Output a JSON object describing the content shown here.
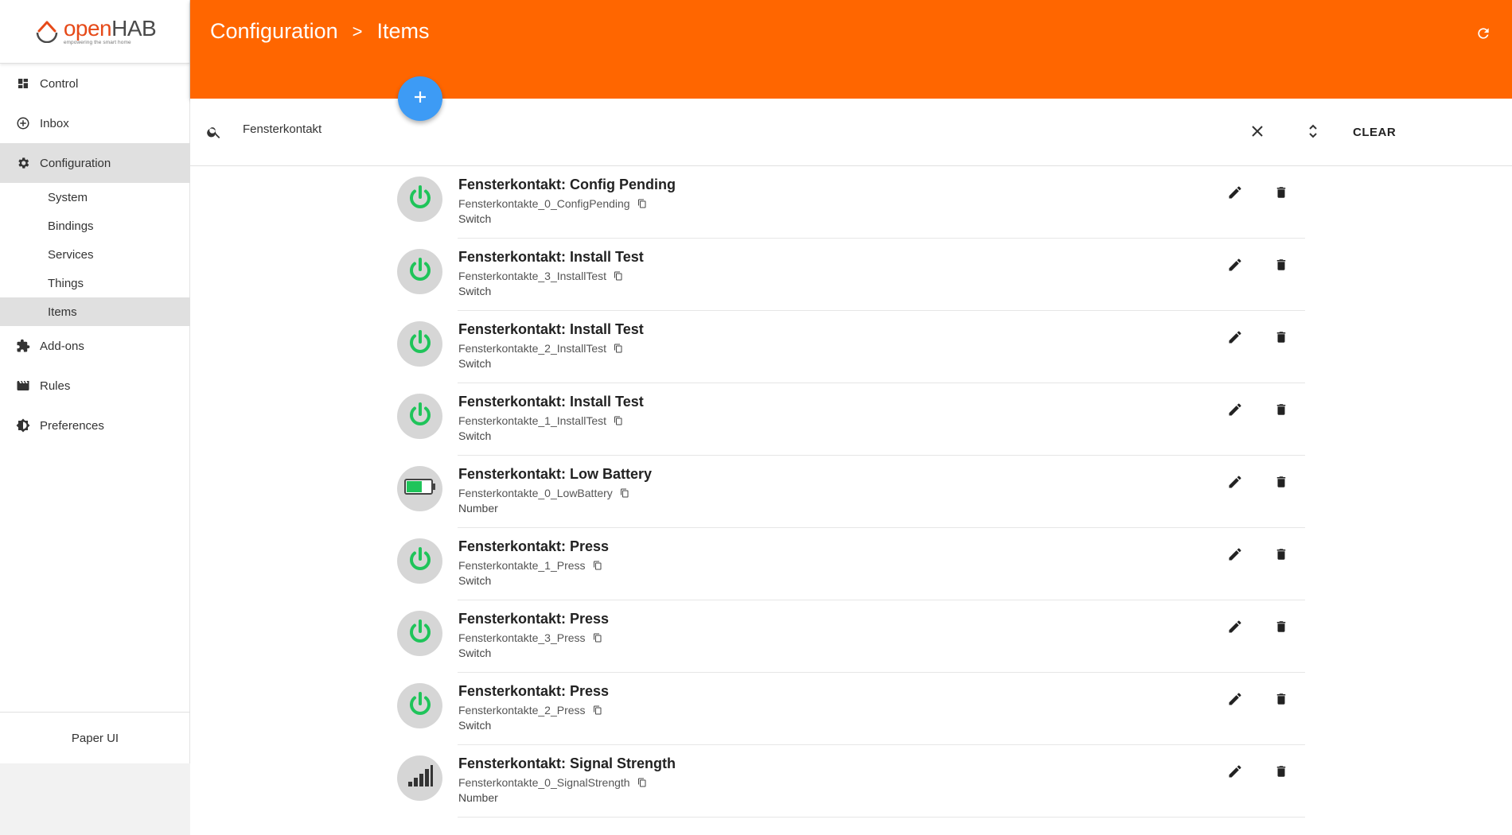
{
  "app": {
    "logo_open": "open",
    "logo_hab": "HAB",
    "logo_tagline": "empowering the smart home",
    "accent_color": "#ff6600",
    "fab_color": "#3d9bf5",
    "status_color": "#1fc45a"
  },
  "header": {
    "crumb1": "Configuration",
    "crumb_sep": ">",
    "crumb2": "Items"
  },
  "sidebar": {
    "control": "Control",
    "inbox": "Inbox",
    "configuration": "Configuration",
    "system": "System",
    "bindings": "Bindings",
    "services": "Services",
    "things": "Things",
    "items": "Items",
    "addons": "Add-ons",
    "rules": "Rules",
    "preferences": "Preferences",
    "footer": "Paper UI"
  },
  "search": {
    "value": "Fensterkontakt",
    "clear_label": "CLEAR"
  },
  "items": [
    {
      "label": "Fensterkontakt: Config Pending",
      "name": "Fensterkontakte_0_ConfigPending",
      "type": "Switch",
      "icon": "power-icon"
    },
    {
      "label": "Fensterkontakt: Install Test",
      "name": "Fensterkontakte_3_InstallTest",
      "type": "Switch",
      "icon": "power-icon"
    },
    {
      "label": "Fensterkontakt: Install Test",
      "name": "Fensterkontakte_2_InstallTest",
      "type": "Switch",
      "icon": "power-icon"
    },
    {
      "label": "Fensterkontakt: Install Test",
      "name": "Fensterkontakte_1_InstallTest",
      "type": "Switch",
      "icon": "power-icon"
    },
    {
      "label": "Fensterkontakt: Low Battery",
      "name": "Fensterkontakte_0_LowBattery",
      "type": "Number",
      "icon": "battery-icon"
    },
    {
      "label": "Fensterkontakt: Press",
      "name": "Fensterkontakte_1_Press",
      "type": "Switch",
      "icon": "power-icon"
    },
    {
      "label": "Fensterkontakt: Press",
      "name": "Fensterkontakte_3_Press",
      "type": "Switch",
      "icon": "power-icon"
    },
    {
      "label": "Fensterkontakt: Press",
      "name": "Fensterkontakte_2_Press",
      "type": "Switch",
      "icon": "power-icon"
    },
    {
      "label": "Fensterkontakt: Signal Strength",
      "name": "Fensterkontakte_0_SignalStrength",
      "type": "Number",
      "icon": "signal-icon"
    }
  ]
}
